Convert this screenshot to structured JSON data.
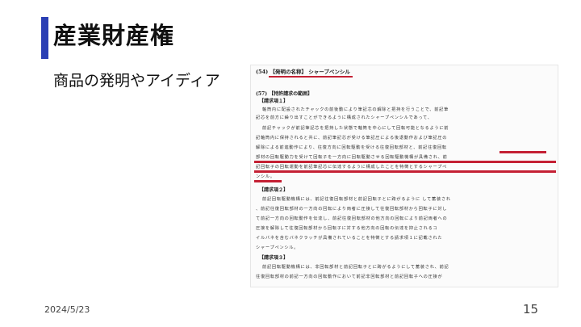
{
  "slide": {
    "title": "産業財産権",
    "subtitle": "商品の発明やアイディア",
    "date": "2024/5/23",
    "page_number": "15",
    "accent_color": "#2b3fb4",
    "highlight_color": "#c42034"
  },
  "patent": {
    "invention_title_line": "(54) 【発明の名称】 シャープペンシル",
    "claims_heading": "(57) 【特許請求の範囲】",
    "claim1_heading": "【請求項１】",
    "claim1_lines": [
      "軸筒内に配設されたチャックの前後動により筆記芯の解除と把持を行うことで、前記筆",
      "記芯を前方に繰り出すことができるように構成されたシャープペンシルであって、",
      "前記チャックが前記筆記芯を把持した状態で軸筒を中心にして回転可能となるように前",
      "記軸筒内に保持されると共に、前記筆記芯が受ける筆記圧による後退動作および筆記圧の",
      "解除による前進動作により、往復方向に回転駆動を受ける往復回転部材と、前記往復回転",
      "部材の回転駆動力を受けて回転子を一方向に回転駆動させる回転駆動機構が具備され、前",
      "記回転子の回転運動を前記筆記芯に伝達するように構成したことを特徴とするシャープペ",
      "ンシル。"
    ],
    "claim2_heading": "【請求項２】",
    "claim2_lines": [
      "前記回転駆動機構には、前記往復回転部材と前記回転子とに跨がるように して蓄装され",
      "、前記往復回転部材の一方向の回転により両者に圧接して往復回転部材から回転子に対し",
      "て前記一方向の回転動作を伝達し、前記往復回転部材の他方向の回転により前記両者への",
      "圧接を解除して往復回転部材から回転子に対する他方向の回転の伝達を抑止されるコ",
      "イルバネを含むバネクラッチが具備されていることを特徴とする請求項１に記載された",
      "シャープペンシル。"
    ],
    "claim3_heading": "【請求項３】",
    "claim3_lines": [
      "前記回転駆動機構には、非回転部材と前記回転子とに跨がるようにして蓄装され、前記",
      "往復回転部材の前記一方向の回転動作において前記非回転部材と前記回転子への圧接が"
    ]
  }
}
